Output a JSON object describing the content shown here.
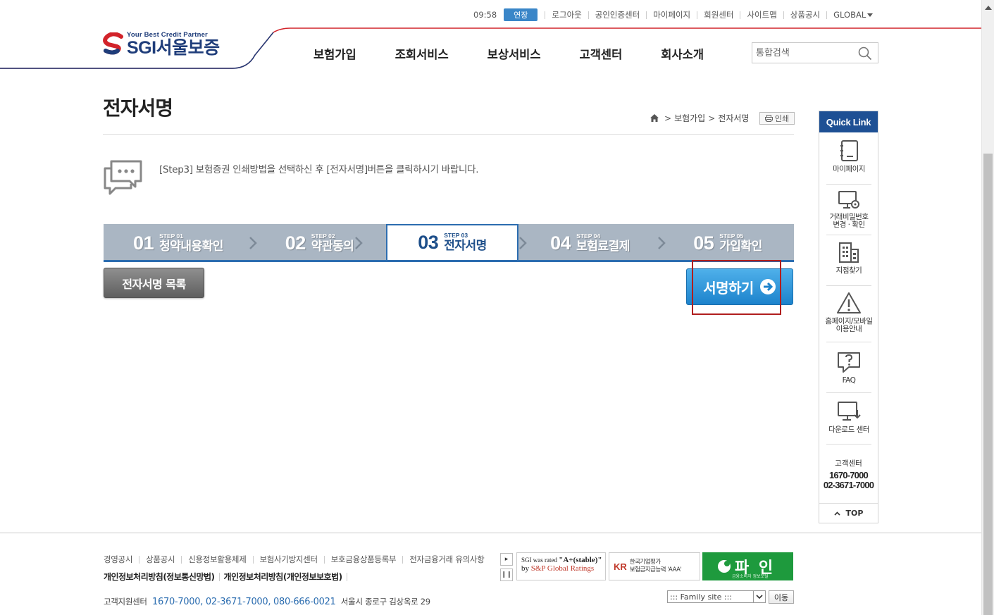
{
  "util": {
    "time": "09:58",
    "extend_label": "연장",
    "links": [
      "로그아웃",
      "공인인증센터",
      "마이페이지",
      "회원센터",
      "사이트맵",
      "상품공시",
      "GLOBAL"
    ]
  },
  "logo": {
    "tagline": "Your Best Credit Partner",
    "name": "SGI서울보증"
  },
  "gnb": [
    "보험가입",
    "조회서비스",
    "보상서비스",
    "고객센터",
    "회사소개"
  ],
  "search": {
    "placeholder": "통합검색"
  },
  "page": {
    "title": "전자서명",
    "breadcrumb": [
      "보험가입",
      "전자서명"
    ],
    "print_label": "인쇄",
    "notice": "[Step3] 보험증권 인쇄방법을 선택하신 후 [전자서명]버튼을 클릭하시기 바랍니다."
  },
  "steps": [
    {
      "num": "01",
      "small": "STEP 01",
      "label": "청약내용확인",
      "active": false
    },
    {
      "num": "02",
      "small": "STEP 02",
      "label": "약관동의",
      "active": false
    },
    {
      "num": "03",
      "small": "STEP 03",
      "label": "전자서명",
      "active": true
    },
    {
      "num": "04",
      "small": "STEP 04",
      "label": "보험료결제",
      "active": false
    },
    {
      "num": "05",
      "small": "STEP 05",
      "label": "가입확인",
      "active": false
    }
  ],
  "buttons": {
    "list": "전자서명 목록",
    "sign": "서명하기"
  },
  "quicklink": {
    "title": "Quick Link",
    "items": [
      {
        "icon": "notebook-icon",
        "label": "마이페이지"
      },
      {
        "icon": "monitor-lock-icon",
        "label_1": "거래비밀번호",
        "label_2": "변경 · 확인"
      },
      {
        "icon": "building-icon",
        "label": "지점찾기"
      },
      {
        "icon": "warning-icon",
        "label_1": "홈페이지/모바일",
        "label_2": "이용안내"
      },
      {
        "icon": "faq-icon",
        "label": "FAQ"
      },
      {
        "icon": "download-icon",
        "label": "다운로드 센터"
      }
    ],
    "cs_title": "고객센터",
    "cs_phone_1": "1670-7000",
    "cs_phone_2": "02-3671-7000",
    "top_label": "TOP"
  },
  "footer": {
    "links": [
      "경영공시",
      "상품공시",
      "신용정보활용체제",
      "보험사기방지센터",
      "보호금융상품등록부",
      "전자금융거래 유의사항"
    ],
    "policies": [
      "개인정보처리방침(정보통신망법)",
      "개인정보처리방침(개인정보보호법)"
    ],
    "cs_label": "고객지원센터",
    "cs_phones": "1670-7000, 02-3671-7000, 080-666-0021",
    "address": "서울시 종로구 김상옥로 29",
    "banner1_l1a": "SGI was rated ",
    "banner1_l1b": "\"A+(stable)\"",
    "banner1_l2a": "by ",
    "banner1_l2b": "S&P Global Ratings",
    "banner2_logo": "KR",
    "banner2_l1": "한국기업평가",
    "banner2_l2": "보험금지급능력 'AAA'",
    "banner3_main": "파 인",
    "banner3_sub": "금융소비자 정보포털",
    "family_site": "::: Family site :::",
    "go_label": "이동"
  },
  "colors": {
    "brand_navy": "#1f3d7a",
    "accent_red": "#d2232a",
    "step_active": "#2c6db0",
    "sign_button": "#1d83cc",
    "quicklink_head": "#1e5094"
  }
}
